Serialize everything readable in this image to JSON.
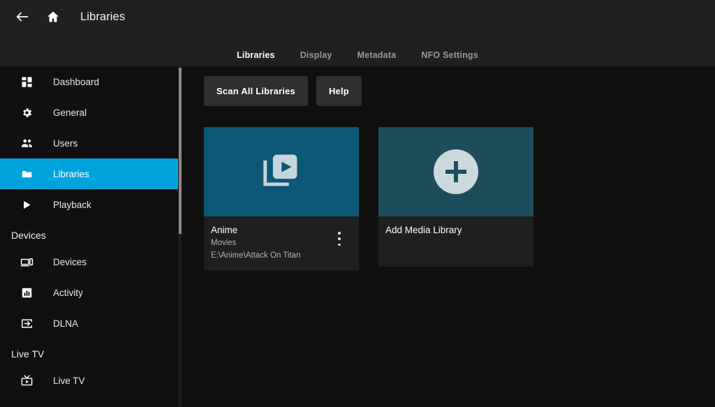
{
  "header": {
    "back_icon": "arrow-left-icon",
    "home_icon": "home-icon",
    "title": "Libraries",
    "tabs": [
      {
        "label": "Libraries",
        "active": true
      },
      {
        "label": "Display",
        "active": false
      },
      {
        "label": "Metadata",
        "active": false
      },
      {
        "label": "NFO Settings",
        "active": false
      }
    ]
  },
  "sidebar": {
    "items": [
      {
        "label": "Dashboard",
        "icon": "dashboard-icon",
        "active": false
      },
      {
        "label": "General",
        "icon": "gear-icon",
        "active": false
      },
      {
        "label": "Users",
        "icon": "users-icon",
        "active": false
      },
      {
        "label": "Libraries",
        "icon": "folder-icon",
        "active": true
      },
      {
        "label": "Playback",
        "icon": "play-icon",
        "active": false
      }
    ],
    "sections": [
      {
        "title": "Devices",
        "items": [
          {
            "label": "Devices",
            "icon": "devices-icon"
          },
          {
            "label": "Activity",
            "icon": "activity-icon"
          },
          {
            "label": "DLNA",
            "icon": "dlna-icon"
          }
        ]
      },
      {
        "title": "Live TV",
        "items": [
          {
            "label": "Live TV",
            "icon": "live-tv-icon"
          }
        ]
      }
    ]
  },
  "main": {
    "buttons": [
      {
        "label": "Scan All Libraries"
      },
      {
        "label": "Help"
      }
    ],
    "cards": [
      {
        "type": "library",
        "icon": "video-library-icon",
        "title": "Anime",
        "media_type": "Movies",
        "path": "E:\\Anime\\Attack On Titan",
        "menu_icon": "more-vertical-icon",
        "image_color": "#0d5674"
      },
      {
        "type": "add",
        "icon": "plus-circle-icon",
        "title": "Add Media Library",
        "image_color": "#1d4d5c"
      }
    ]
  },
  "colors": {
    "accent": "#00a4dc",
    "header_bg": "#202020",
    "body_bg": "#101010",
    "card_footer_bg": "#1f1f1f",
    "button_bg": "#2f2f2f"
  }
}
